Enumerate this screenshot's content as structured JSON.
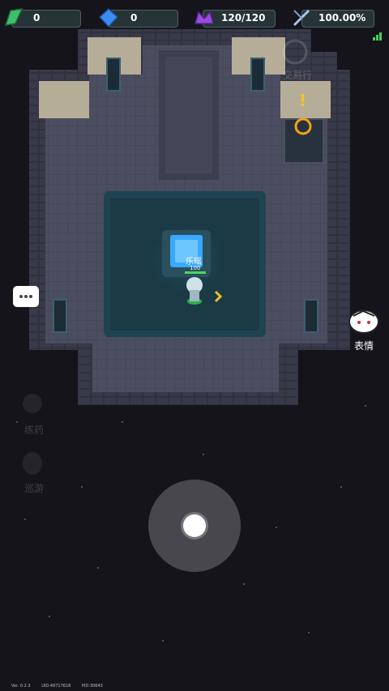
{
  "hud": {
    "resources": [
      {
        "id": "energy",
        "icon": "green-crystal-icon",
        "value": "0"
      },
      {
        "id": "gems",
        "icon": "blue-gem-icon",
        "value": "0"
      },
      {
        "id": "stamina",
        "icon": "purple-crown-icon",
        "value": "120/120"
      },
      {
        "id": "progress",
        "icon": "crossed-swords-icon",
        "value": "100.00%"
      }
    ],
    "signal_icon": "signal-strength-icon"
  },
  "map": {
    "trade_label": "交易行",
    "npc_alert": "!",
    "player": {
      "name": "乐瑶",
      "hp": "100",
      "hp_fraction": 1.0
    }
  },
  "side_menu": {
    "chat_icon": "chat-bubble-icon",
    "emote_label": "表情",
    "faded_buttons": [
      "",
      "练药",
      "巡游"
    ]
  },
  "footer": {
    "version": "Ver. 0.2.3",
    "uid": "UID:49717618",
    "pid": "PID:30643"
  },
  "colors": {
    "floor": "#4a4d5e",
    "wall": "#2e3140",
    "stone_light": "#bdb3a0",
    "pool": "#1b3a46",
    "portal": "#39a8ff",
    "hp_green": "#4bd463"
  }
}
